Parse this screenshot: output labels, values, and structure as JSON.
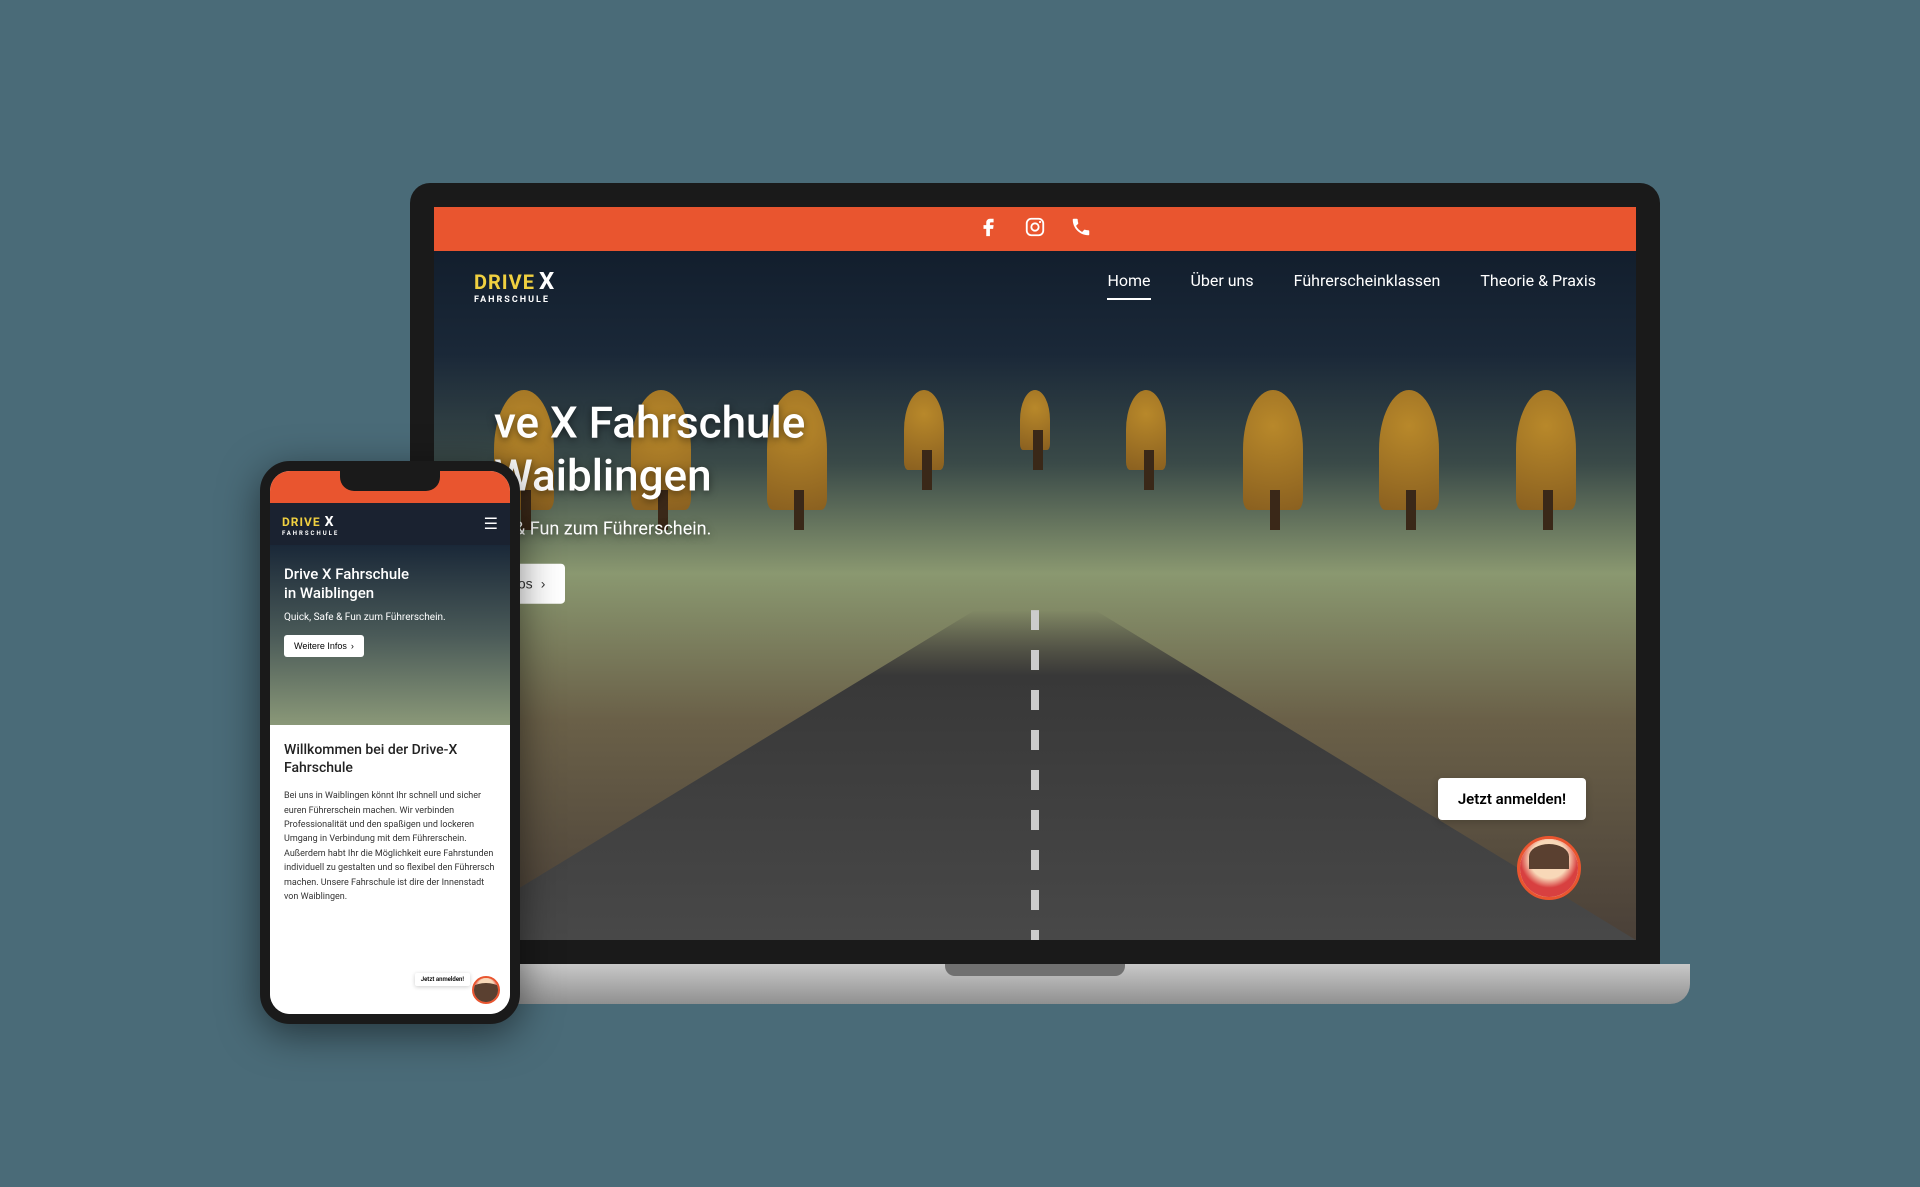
{
  "brand": {
    "name_primary": "DRIVE",
    "name_accent": "X",
    "name_sub": "FAHRSCHULE",
    "accent_color": "#e9552f",
    "highlight_color": "#f0d040"
  },
  "nav": {
    "items": [
      {
        "label": "Home",
        "active": true
      },
      {
        "label": "Über uns",
        "active": false
      },
      {
        "label": "Führerscheinklassen",
        "active": false
      },
      {
        "label": "Theorie & Praxis",
        "active": false
      }
    ]
  },
  "hero": {
    "title_line1_visible": "ve X Fahrschule",
    "title_line2_visible": "Waiblingen",
    "subtitle_visible": "fe & Fun zum Führerschein.",
    "cta_label_visible": "fos",
    "cta_icon": "›"
  },
  "chat": {
    "bubble_text": "Jetzt anmelden!"
  },
  "mobile": {
    "hero_title_line1": "Drive X Fahrschule",
    "hero_title_line2": "in Waiblingen",
    "hero_subtitle": "Quick, Safe & Fun zum Führerschein.",
    "cta_label": "Weitere Infos",
    "cta_icon": "›",
    "welcome_heading": "Willkommen bei der Drive-X Fahrschule",
    "welcome_body": "Bei uns in Waiblingen könnt Ihr schnell und sicher euren Führerschein machen. Wir verbinden Professionalität und den spaßigen und lockeren Umgang in Verbindung mit dem Führerschein. Außerdem habt Ihr die Möglichkeit eure Fahrstunden individuell zu gestalten und so flexibel den Führersch machen. Unsere Fahrschule ist dire der Innenstadt von Waiblingen.",
    "chat_bubble": "Jetzt anmelden!"
  }
}
